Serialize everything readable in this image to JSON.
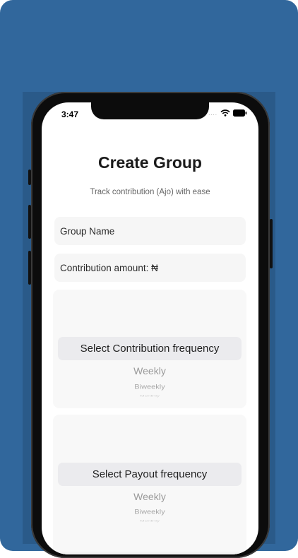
{
  "status_bar": {
    "time": "3:47",
    "signal_dots": "....",
    "icons": [
      "wifi-icon",
      "battery-icon"
    ]
  },
  "colors": {
    "background_blue": "#31679c",
    "field_background": "#f6f6f6",
    "picker_highlight": "#ebebee"
  },
  "page": {
    "title": "Create Group",
    "subtitle": "Track contribution (Ajo) with ease"
  },
  "form": {
    "group_name_placeholder": "Group Name",
    "contribution_amount_placeholder": "Contribution amount: ₦"
  },
  "contribution_picker": {
    "selected": "Select Contribution frequency",
    "options": [
      "Weekly",
      "Biweekly",
      "Monthly"
    ]
  },
  "payout_picker": {
    "selected": "Select Payout frequency",
    "options": [
      "Weekly",
      "Biweekly",
      "Monthly"
    ]
  }
}
